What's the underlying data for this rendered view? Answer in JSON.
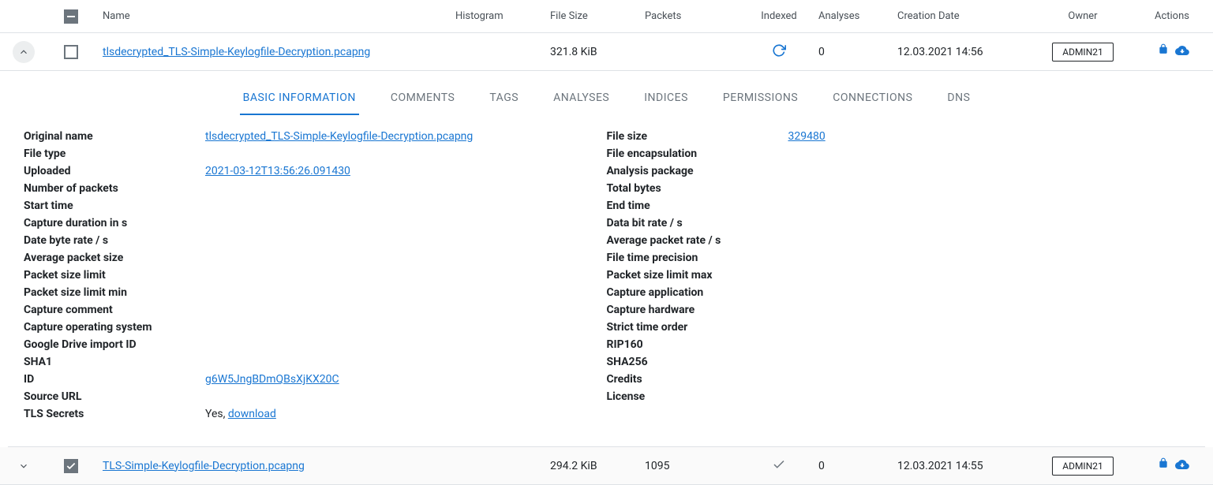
{
  "columns": {
    "name": "Name",
    "histogram": "Histogram",
    "filesize": "File Size",
    "packets": "Packets",
    "indexed": "Indexed",
    "analyses": "Analyses",
    "creation": "Creation Date",
    "owner": "Owner",
    "actions": "Actions"
  },
  "rows": [
    {
      "name": "tlsdecrypted_TLS-Simple-Keylogfile-Decryption.pcapng",
      "size": "321.8 KiB",
      "packets": "",
      "analyses": "0",
      "creation": "12.03.2021 14:56",
      "owner": "ADMIN21"
    },
    {
      "name": "TLS-Simple-Keylogfile-Decryption.pcapng",
      "size": "294.2 KiB",
      "packets": "1095",
      "analyses": "0",
      "creation": "12.03.2021 14:55",
      "owner": "ADMIN21"
    }
  ],
  "tabs": {
    "basic": "BASIC INFORMATION",
    "comments": "COMMENTS",
    "tags": "TAGS",
    "analyses": "ANALYSES",
    "indices": "INDICES",
    "permissions": "PERMISSIONS",
    "connections": "CONNECTIONS",
    "dns": "DNS"
  },
  "details": {
    "left": {
      "original_name": {
        "label": "Original name",
        "value": "tlsdecrypted_TLS-Simple-Keylogfile-Decryption.pcapng",
        "link": true
      },
      "file_type": {
        "label": "File type",
        "value": ""
      },
      "uploaded": {
        "label": "Uploaded",
        "value": "2021-03-12T13:56:26.091430",
        "link": true
      },
      "num_packets": {
        "label": "Number of packets",
        "value": ""
      },
      "start_time": {
        "label": "Start time",
        "value": ""
      },
      "capture_duration": {
        "label": "Capture duration in s",
        "value": ""
      },
      "date_byte_rate": {
        "label": "Date byte rate / s",
        "value": ""
      },
      "avg_packet_size": {
        "label": "Average packet size",
        "value": ""
      },
      "packet_size_limit": {
        "label": "Packet size limit",
        "value": ""
      },
      "packet_size_limit_min": {
        "label": "Packet size limit min",
        "value": ""
      },
      "capture_comment": {
        "label": "Capture comment",
        "value": ""
      },
      "capture_os": {
        "label": "Capture operating system",
        "value": ""
      },
      "gdrive_id": {
        "label": "Google Drive import ID",
        "value": ""
      },
      "sha1": {
        "label": "SHA1",
        "value": ""
      },
      "id": {
        "label": "ID",
        "value": "g6W5JngBDmQBsXjKX20C",
        "link": true
      },
      "source_url": {
        "label": "Source URL",
        "value": ""
      },
      "tls_secrets": {
        "label": "TLS Secrets",
        "prefix": "Yes, ",
        "value": "download",
        "link": true
      }
    },
    "right": {
      "file_size": {
        "label": "File size",
        "value": "329480",
        "link": true
      },
      "file_encap": {
        "label": "File encapsulation",
        "value": ""
      },
      "analysis_pkg": {
        "label": "Analysis package",
        "value": ""
      },
      "total_bytes": {
        "label": "Total bytes",
        "value": ""
      },
      "end_time": {
        "label": "End time",
        "value": ""
      },
      "data_bit_rate": {
        "label": "Data bit rate / s",
        "value": ""
      },
      "avg_packet_rate": {
        "label": "Average packet rate / s",
        "value": ""
      },
      "file_time_precision": {
        "label": "File time precision",
        "value": ""
      },
      "packet_size_limit_max": {
        "label": "Packet size limit max",
        "value": ""
      },
      "capture_app": {
        "label": "Capture application",
        "value": ""
      },
      "capture_hw": {
        "label": "Capture hardware",
        "value": ""
      },
      "strict_time_order": {
        "label": "Strict time order",
        "value": ""
      },
      "rip160": {
        "label": "RIP160",
        "value": ""
      },
      "sha256": {
        "label": "SHA256",
        "value": ""
      },
      "credits": {
        "label": "Credits",
        "value": ""
      },
      "license": {
        "label": "License",
        "value": ""
      }
    }
  }
}
